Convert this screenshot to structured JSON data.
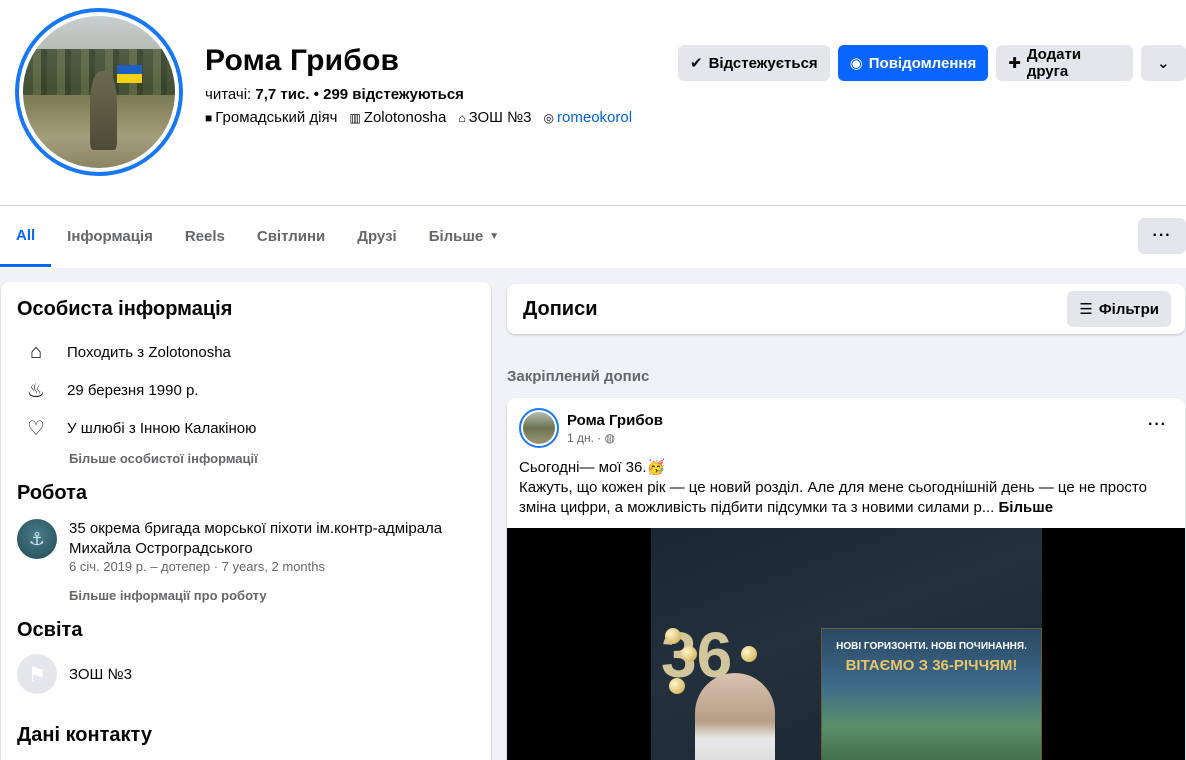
{
  "profile": {
    "name": "Рома Грибов",
    "followers_label": "читачі:",
    "followers_count": "7,7 тис.",
    "following_text": "• 299 відстежуються",
    "tags": [
      {
        "icon": "briefcase-icon",
        "text": "Громадський діяч"
      },
      {
        "icon": "building-icon",
        "text": "Zolotonosha"
      },
      {
        "icon": "school-icon",
        "text": "ЗОШ №3"
      },
      {
        "icon": "instagram-icon",
        "text": "romeokorol"
      }
    ],
    "flag_colors": [
      "#1f5fbf",
      "#f5d20b"
    ]
  },
  "actions": {
    "following": "Відстежується",
    "message": "Повідомлення",
    "add_friend": "Додати друга"
  },
  "tabs": [
    "All",
    "Інформація",
    "Reels",
    "Світлини",
    "Друзі",
    "Більше"
  ],
  "intro": {
    "personal_title": "Особиста інформація",
    "from": "Походить з Zolotonosha",
    "birthday": "29 березня 1990 р.",
    "relationship_prefix": "У шлюбі з ",
    "relationship_name": "Інною Калакіною",
    "personal_more": "Більше особистої інформації",
    "work_title": "Робота",
    "work_name": "35 окрема бригада морської піхоти ім.контр-адмірала Михайла Остроградського",
    "work_dates": "6 січ. 2019 р. – дотепер · 7 years, 2 months",
    "work_more": "Більше інформації про роботу",
    "edu_title": "Освіта",
    "school": "ЗОШ №3",
    "contacts_title": "Дані контакту"
  },
  "posts": {
    "title": "Дописи",
    "filters": "Фільтри",
    "pinned_label": "Закріплений допис",
    "post": {
      "author": "Рома Грибов",
      "time": "1 дн. ·",
      "line1": "Сьогодні— мої 36.🥳",
      "line2": "Кажуть, що кожен рік — це новий розділ. Але для мене сьогоднішній день — це не просто зміна цифри, а можливість підбити підсумки та з новими силами р...",
      "more": "Більше",
      "banner_line1": "НОВІ ГОРИЗОНТИ. НОВІ ПОЧИНАННЯ.",
      "banner_line2": "ВІТАЄМО З 36-РІЧЧЯМ!",
      "decor_number": "36"
    }
  },
  "colors": {
    "accent": "#0866ff",
    "ring": "#1877f2",
    "bg": "#f0f2f5"
  }
}
